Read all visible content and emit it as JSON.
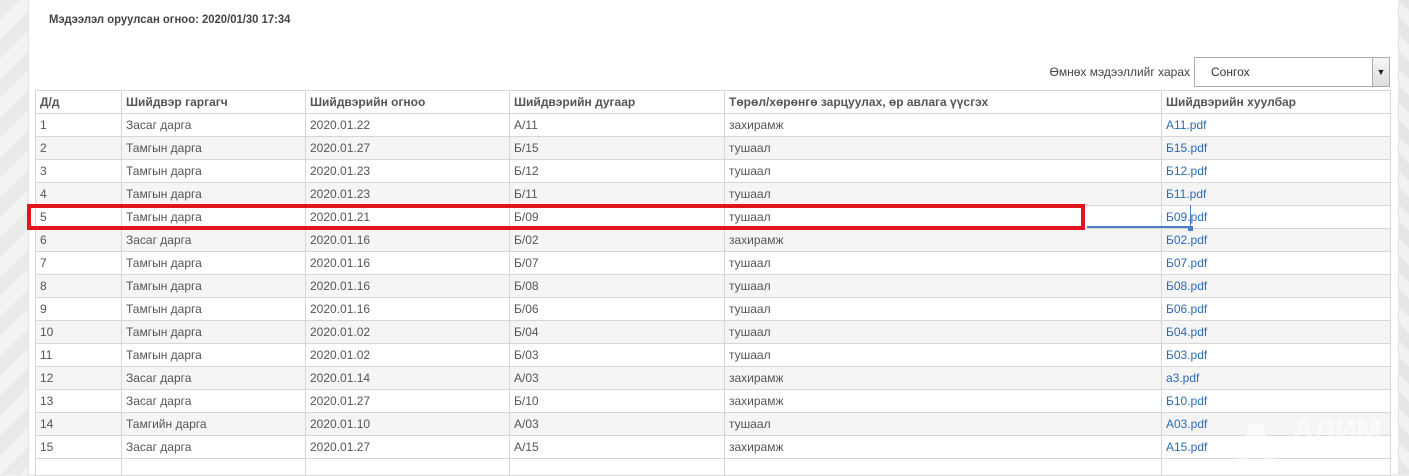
{
  "header": {
    "upload_date": "Мэдээлэл оруулсан огноо: 2020/01/30 17:34"
  },
  "history": {
    "label": "Өмнөх мэдээллийг харах",
    "selected": "Сонгох"
  },
  "table": {
    "columns": [
      "Д/д",
      "Шийдвэр гаргагч",
      "Шийдвэрийн огноо",
      "Шийдвэрийн дугаар",
      "Төрөл/хөрөнгө зарцуулах, өр авлага үүсгэх",
      "Шийдвэрийн хуулбар"
    ],
    "rows": [
      {
        "no": "1",
        "issuer": "Засаг дарга",
        "date": "2020.01.22",
        "number": "А/11",
        "type": "захирамж",
        "file": "А11.pdf"
      },
      {
        "no": "2",
        "issuer": "Тамгын дарга",
        "date": "2020.01.27",
        "number": "Б/15",
        "type": "тушаал",
        "file": "Б15.pdf"
      },
      {
        "no": "3",
        "issuer": "Тамгын дарга",
        "date": "2020.01.23",
        "number": "Б/12",
        "type": "тушаал",
        "file": "Б12.pdf"
      },
      {
        "no": "4",
        "issuer": "Тамгын дарга",
        "date": "2020.01.23",
        "number": "Б/11",
        "type": "тушаал",
        "file": "Б11.pdf"
      },
      {
        "no": "5",
        "issuer": "Тамгын дарга",
        "date": "2020.01.21",
        "number": "Б/09",
        "type": "тушаал",
        "file": "Б09.pdf"
      },
      {
        "no": "6",
        "issuer": "Засаг дарга",
        "date": "2020.01.16",
        "number": "Б/02",
        "type": "захирамж",
        "file": "Б02.pdf"
      },
      {
        "no": "7",
        "issuer": "Тамгын дарга",
        "date": "2020.01.16",
        "number": "Б/07",
        "type": "тушаал",
        "file": "Б07.pdf"
      },
      {
        "no": "8",
        "issuer": "Тамгын дарга",
        "date": "2020.01.16",
        "number": "Б/08",
        "type": "тушаал",
        "file": "Б08.pdf"
      },
      {
        "no": "9",
        "issuer": "Тамгын дарга",
        "date": "2020.01.16",
        "number": "Б/06",
        "type": "тушаал",
        "file": "Б06.pdf"
      },
      {
        "no": "10",
        "issuer": "Тамгын дарга",
        "date": "2020.01.02",
        "number": "Б/04",
        "type": "тушаал",
        "file": "Б04.pdf"
      },
      {
        "no": "11",
        "issuer": "Тамгын дарга",
        "date": "2020.01.02",
        "number": "Б/03",
        "type": "тушаал",
        "file": "Б03.pdf"
      },
      {
        "no": "12",
        "issuer": "Засаг дарга",
        "date": "2020.01.14",
        "number": "А/03",
        "type": "захирамж",
        "file": "а3.pdf"
      },
      {
        "no": "13",
        "issuer": "Засаг дарга",
        "date": "2020.01.27",
        "number": "Б/10",
        "type": "захирамж",
        "file": "Б10.pdf"
      },
      {
        "no": "14",
        "issuer": "Тамгийн дарга",
        "date": "2020.01.10",
        "number": "А/03",
        "type": "тушаал",
        "file": "А03.pdf"
      },
      {
        "no": "15",
        "issuer": "Засаг дарга",
        "date": "2020.01.27",
        "number": "А/15",
        "type": "захирамж",
        "file": "А15.pdf"
      }
    ]
  },
  "highlight": {
    "row_no": "5",
    "color": "#e2141e"
  },
  "colors": {
    "link": "#2a6bb5",
    "row_stripe": "#f5f5f5",
    "border": "#d6d6d6"
  },
  "watermark": {
    "text": "АЛИМ"
  }
}
